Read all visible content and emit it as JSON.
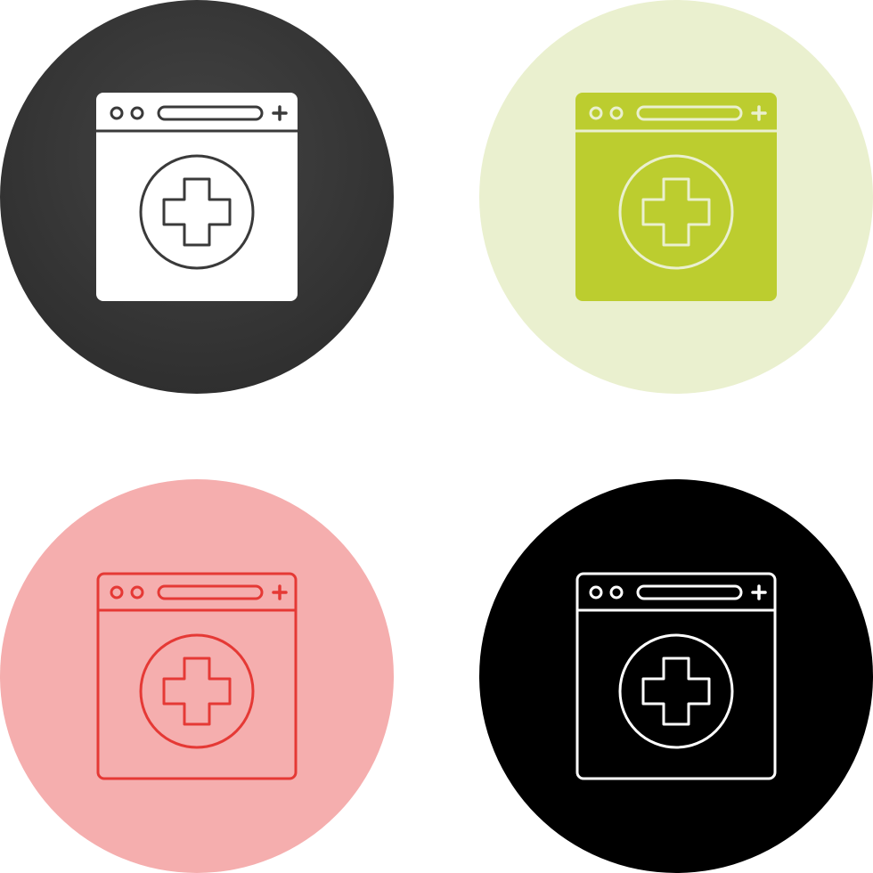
{
  "icon_set": {
    "variants": [
      {
        "id": "glyph-dark",
        "icon": "medical-browser-icon",
        "style": "glyph",
        "colors": {
          "circle": "#3a3a3a",
          "window": "#ffffff",
          "detail": "#3a3a3a"
        }
      },
      {
        "id": "glyph-lime",
        "icon": "medical-browser-icon",
        "style": "glyph",
        "colors": {
          "circle": "#eaf0cf",
          "window": "#bccd2f",
          "detail": "#eaf0cf"
        }
      },
      {
        "id": "outline-red",
        "icon": "medical-browser-icon",
        "style": "outline",
        "colors": {
          "circle": "#f5aeae",
          "window": "none",
          "detail": "#e53935"
        }
      },
      {
        "id": "outline-black",
        "icon": "medical-browser-icon",
        "style": "outline",
        "colors": {
          "circle": "#000000",
          "window": "none",
          "detail": "#ffffff"
        }
      }
    ]
  }
}
